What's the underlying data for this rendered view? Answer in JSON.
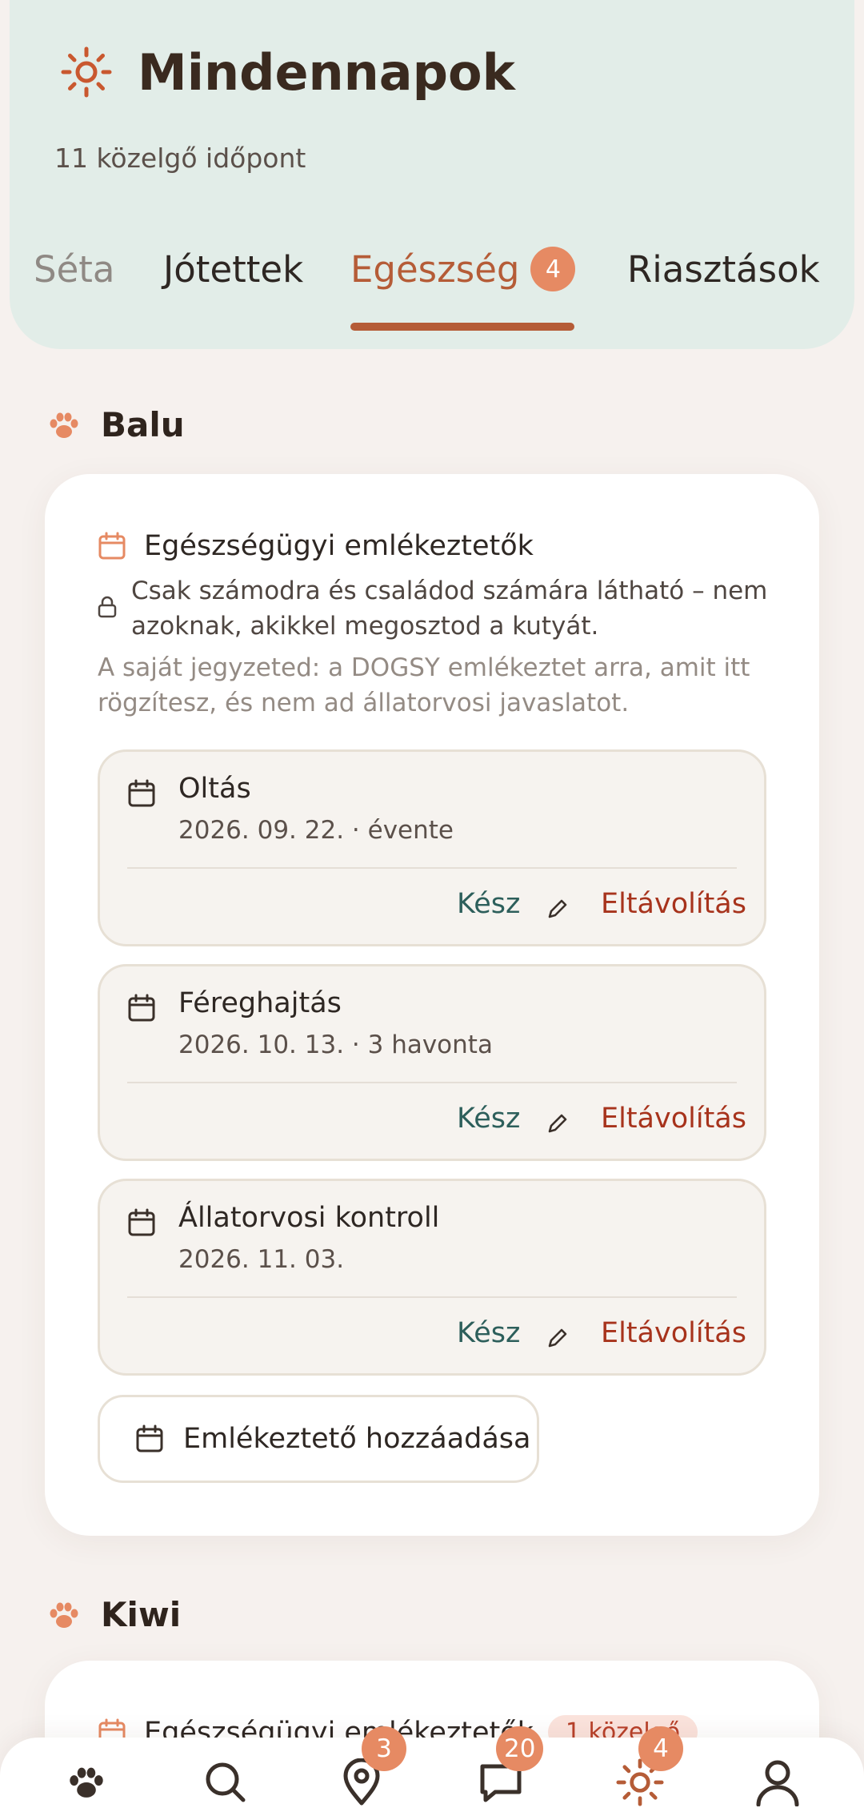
{
  "header": {
    "title": "Mindennapok",
    "subtitle": "11 közelgő időpont",
    "tabs": [
      {
        "label": "Séta"
      },
      {
        "label": "Jótettek"
      },
      {
        "label": "Egészség",
        "badge": "4"
      },
      {
        "label": "Riasztások"
      }
    ],
    "active_tab": "Egészség"
  },
  "sections": [
    {
      "dog_name": "Balu",
      "card": {
        "title": "Egészségügyi emlékeztetők",
        "privacy": "Csak számodra és családod számára látható – nem azoknak, akikkel megosztod a kutyát.",
        "note": "A saját jegyzeted: a DOGSY emlékeztet arra, amit itt rögzítesz, és nem ad állatorvosi javaslatot.",
        "reminders": [
          {
            "name": "Oltás",
            "date": "2026. 09. 22. · évente",
            "done": "Kész",
            "remove": "Eltávolítás"
          },
          {
            "name": "Féreghajtás",
            "date": "2026. 10. 13. · 3 havonta",
            "done": "Kész",
            "remove": "Eltávolítás"
          },
          {
            "name": "Állatorvosi kontroll",
            "date": "2026. 11. 03.",
            "done": "Kész",
            "remove": "Eltávolítás"
          }
        ],
        "add_label": "Emlékeztető hozzáadása"
      }
    },
    {
      "dog_name": "Kiwi",
      "card": {
        "title": "Egészségügyi emlékeztetők",
        "badge": "1 közelgő"
      }
    }
  ],
  "bottom_nav": [
    {
      "icon": "paw-icon"
    },
    {
      "icon": "search-icon"
    },
    {
      "icon": "map-pin-icon",
      "badge": "3"
    },
    {
      "icon": "chat-icon",
      "badge": "20"
    },
    {
      "icon": "sun-icon",
      "badge": "4"
    },
    {
      "icon": "profile-icon"
    }
  ],
  "colors": {
    "accent": "#b55c37",
    "badge": "#e68a63",
    "header_bg": "#e2ede8",
    "done": "#2d5f5b",
    "remove": "#a7331c"
  }
}
